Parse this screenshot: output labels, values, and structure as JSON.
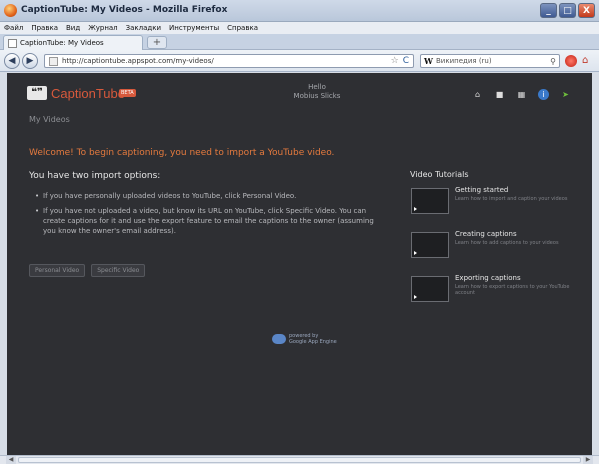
{
  "window": {
    "title": "CaptionTube: My Videos - Mozilla Firefox",
    "controls": {
      "minimize": "_",
      "maximize": "□",
      "close": "X"
    }
  },
  "menu": [
    "Файл",
    "Правка",
    "Вид",
    "Журнал",
    "Закладки",
    "Инструменты",
    "Справка"
  ],
  "tab": {
    "label": "CaptionTube: My Videos",
    "new_tab": "+"
  },
  "nav": {
    "back": "◀",
    "forward": "▶",
    "url": "http://captiontube.appspot.com/my-videos/",
    "star": "☆",
    "reload": "C",
    "search_engine": "W",
    "search_placeholder": "Википедия (ru)",
    "search_icon": "search-icon",
    "home_icon": "home-icon"
  },
  "header": {
    "logo_mark": "❝❞",
    "logo_caption": "Caption",
    "logo_tube": "Tube",
    "logo_badge": "BETA",
    "greeting": "Hello",
    "user": "Mobius Slicks",
    "icons": [
      "home-icon",
      "stop-icon",
      "delete-icon",
      "info-icon",
      "signout-icon"
    ]
  },
  "main": {
    "subtitle": "My Videos",
    "welcome": "Welcome! To begin captioning, you need to import a YouTube video.",
    "options_heading": "You have two import options:",
    "bullets": [
      "If you have personally uploaded videos to YouTube, click Personal Video.",
      "If you have not uploaded a video, but know its URL on YouTube, click Specific Video. You can create captions for it and use the export feature to email the captions to the owner (assuming you know the owner's email address)."
    ],
    "buttons": {
      "personal": "Personal Video",
      "specific": "Specific Video"
    },
    "powered_by": "powered by",
    "powered_brand": "Google App Engine"
  },
  "tutorials": {
    "heading": "Video Tutorials",
    "items": [
      {
        "title": "Getting started",
        "desc": "Learn how to import and caption your videos"
      },
      {
        "title": "Creating captions",
        "desc": "Learn how to add captions to your videos"
      },
      {
        "title": "Exporting captions",
        "desc": "Learn how to export captions to your YouTube account"
      }
    ]
  },
  "colors": {
    "page_bg": "#2e2f33",
    "brand_accent": "#d7593c",
    "welcome_text": "#e57a3e"
  }
}
